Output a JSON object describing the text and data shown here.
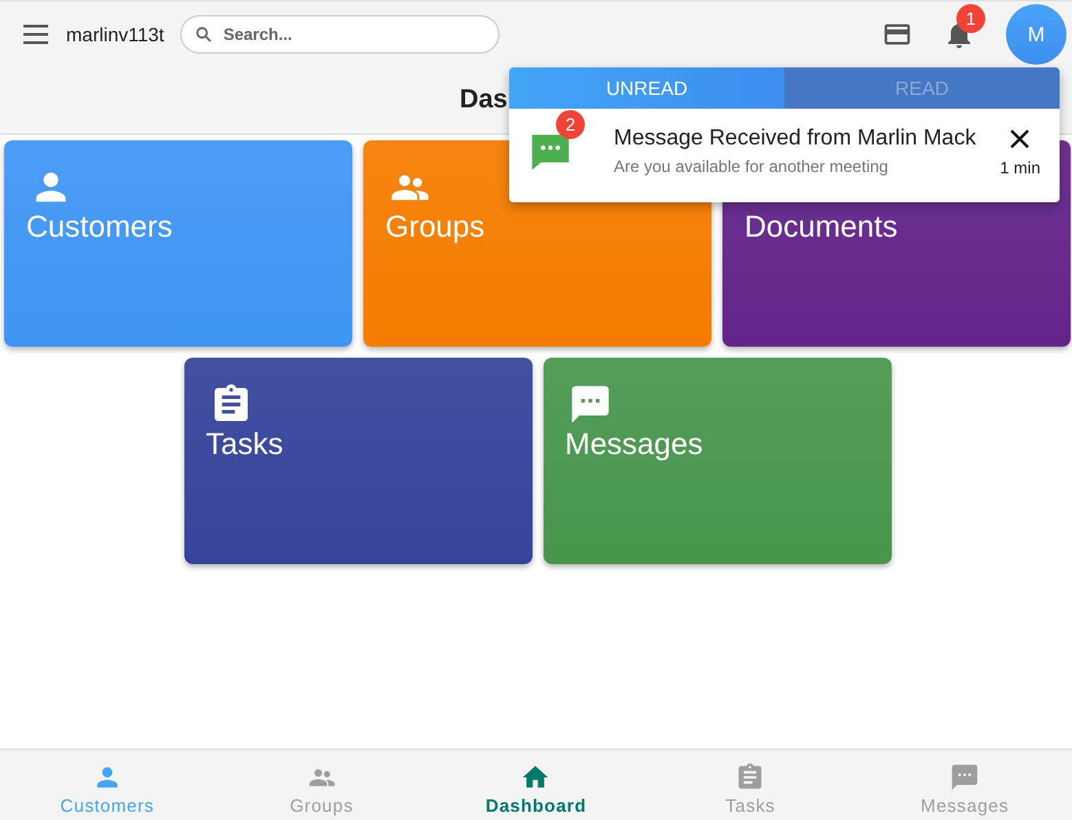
{
  "top_bar": {
    "app_name": "marlinv113t",
    "search": {
      "placeholder": "Search..."
    },
    "notification_count": "1",
    "avatar": "M"
  },
  "page_title": "Das",
  "cards": [
    {
      "label": "Customers",
      "kind": "person",
      "color": "#3f95f3"
    },
    {
      "label": "Groups",
      "kind": "group",
      "color": "#f57c00"
    },
    {
      "label": "Documents",
      "kind": "hidden",
      "color": "#62258a"
    },
    {
      "label": "Tasks",
      "kind": "clipboard",
      "color": "#35449a"
    },
    {
      "label": "Messages",
      "kind": "chat",
      "color": "#47964c"
    }
  ],
  "notifications_popup": {
    "tabs": [
      {
        "label": "UNREAD",
        "selected": true
      },
      {
        "label": "READ",
        "selected": false
      }
    ],
    "items": [
      {
        "count": "2",
        "title": "Message Received from Marlin Mack",
        "body": "Are you available for another meeting",
        "time": "1 min"
      }
    ]
  },
  "bottom_nav": [
    {
      "label": "Customers",
      "kind": "person",
      "selected": false,
      "color": "#42a5f5"
    },
    {
      "label": "Groups",
      "kind": "group",
      "selected": false,
      "color": "#9e9e9e"
    },
    {
      "label": "Dashboard",
      "kind": "home",
      "selected": true,
      "color": "#00796b"
    },
    {
      "label": "Tasks",
      "kind": "clipboard",
      "selected": false,
      "color": "#9e9e9e"
    },
    {
      "label": "Messages",
      "kind": "chat",
      "selected": false,
      "color": "#9e9e9e"
    }
  ]
}
